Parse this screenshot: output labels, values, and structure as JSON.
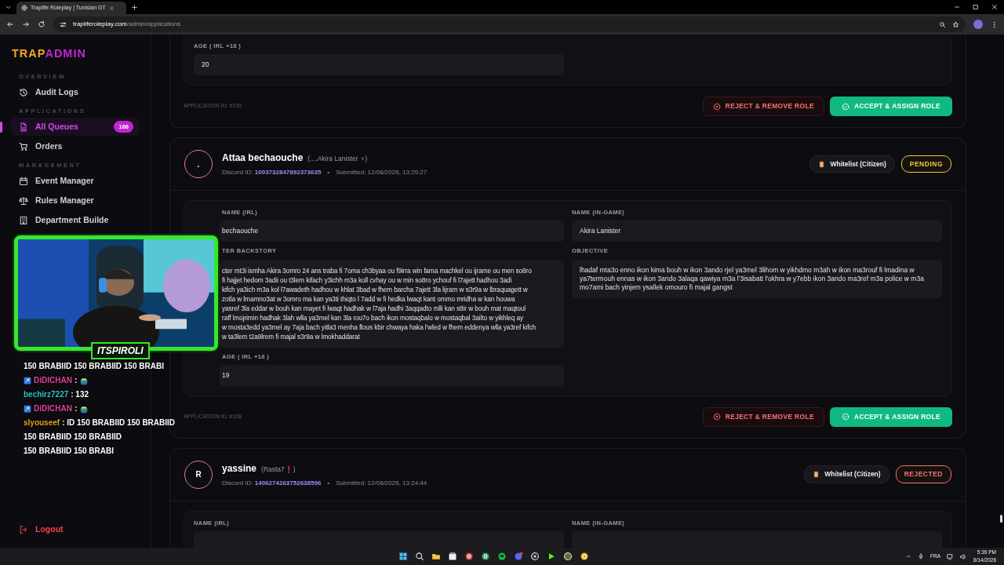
{
  "browser": {
    "tab_title": "Traplife Roleplay | Tunisian GT",
    "url_host": "trapliferoleplay.com",
    "url_path": "/admin/applications"
  },
  "sidebar": {
    "logo": {
      "part1": "TRAP",
      "part2": "ADMIN"
    },
    "sections": [
      {
        "heading": "OVERVIEW",
        "items": [
          {
            "kind": "history",
            "label": "Audit Logs",
            "selected": false
          }
        ]
      },
      {
        "heading": "APPLICATIONS",
        "items": [
          {
            "kind": "file",
            "label": "All Queues",
            "selected": true,
            "badge": "166"
          },
          {
            "kind": "cart",
            "label": "Orders",
            "selected": false
          }
        ]
      },
      {
        "heading": "MANAGEMENT",
        "items": [
          {
            "kind": "calendar",
            "label": "Event Manager",
            "selected": false
          },
          {
            "kind": "scale",
            "label": "Rules Manager",
            "selected": false
          },
          {
            "kind": "building",
            "label": "Department Builde",
            "selected": false
          }
        ]
      }
    ],
    "logout": "Logout"
  },
  "applications": [
    {
      "kind": "partial",
      "fields": [
        {
          "label": "AGE ( IRL +18 )",
          "value": "20"
        }
      ],
      "app_id": "APPLICATION ID: #109",
      "reject": "REJECT & REMOVE ROLE",
      "accept": "ACCEPT & ASSIGN ROLE"
    },
    {
      "kind": "full",
      "avatar": ".",
      "name": "Attaa bechaouche",
      "alias": "(....Akira Lanister ♆)",
      "discord_label": "Discord ID:",
      "discord_id": "1003732847892373635",
      "submitted": "Submitted: 12/08/2026, 13:25:27",
      "type": "Whitelist (Citizen)",
      "separator": "•",
      "status": "PENDING",
      "color": "#f5c542",
      "overlay_cut": true,
      "fields": [
        {
          "label": "NAME (IRL)",
          "value": "bechaouche"
        },
        {
          "label": "NAME (IN-GAME)",
          "value": "Akira Lanister"
        },
        {
          "label": "TER BACKSTORY",
          "lines": [
            "cter mt3i ismha Akira  3omro 24  ans traba fi 7oma ch3byaa ou f9irra win fama machkel ou ijrame ou men so8ro",
            "fi hajjet hedom 3adii ou t3lem kifach y3ichh m3a koll cvhay ou  w min so8ro ychouf fi l7ajett hadhou 3adi",
            "kifch ya3ich m3a kol l7awadeth hadhou w khlat 3bad w fhem barcha 7ajett 3la lijram w s3r9a w lbraquagett w",
            "zotla w lmamno3at w 3omro ma kan ya3ti thiqto l 7add w fi hedka  lwaqt kant ommo mridha w kan houwa",
            "yasref 3la eddar w bouh kan mayet fi lwaqt hadhak w l7aja hadhi 3aqqadto mlli kan s8ir w bouh mat maqtoul",
            "raff lmojrimin hadhak 3lah wlla ya3mel kan 3la rou7o bach ikon mostaqbalo w mostaqbal 3ailto w yikhleq ay",
            "w mosta3edd ya3mel ay 7aja bach yitla3 menha flous kbir chwaya haka l'wled w fhem eddenya wlla ya3ref kifch",
            "w ta3lem t2a9lrem fi majal s3r9a w lmokhaddarat"
          ]
        },
        {
          "label": "OBJECTIVE",
          "value": "lhadaf mta3o enno ikon kima bouh w ikon 3ando rjel ya3mel 3lihom w yikhdmo m3ah w ikon ma3rouf fi lmadina w ya7termouh ennas w ikon 3ando 3alaqa qawiya m3a l'3isabatt l'okhra w y7ebb ikon 3ando ma3ref m3a police w m3a mo7ami bach yinjem ysallek omouro fi majal gangst"
        },
        {
          "label": "AGE ( IRL +18 )",
          "value": "19"
        }
      ],
      "app_id": "APPLICATION ID: #108",
      "reject": "REJECT & REMOVE ROLE",
      "accept": "ACCEPT & ASSIGN ROLE"
    },
    {
      "kind": "full",
      "avatar": "R",
      "name": "yassine",
      "alias": "(Rasta7❗)",
      "discord_label": "Discord ID:",
      "discord_id": "1406274263752638596",
      "submitted": "Submitted: 12/08/2026, 13:24:44",
      "type": "Whitelist (Citizen)",
      "separator": "•",
      "status": "REJECTED",
      "color": "#f87171",
      "overlay_cut": false,
      "fields": [
        {
          "label": "NAME (IRL)"
        },
        {
          "label": "NAME (IN-GAME)"
        }
      ]
    }
  ],
  "stream": {
    "streamer": "ITSPIROLI",
    "chat": [
      {
        "kind": "text",
        "text": "150 BRABIID 150 BRABIID 150 BRABI"
      },
      {
        "kind": "message",
        "badge": true,
        "user": "DiDICHAN",
        "color": "#e0409a",
        "text": ":",
        "emote": true
      },
      {
        "kind": "message",
        "badge": false,
        "user": "bechirz7227",
        "color": "#2ec4c4",
        "text": ": 132",
        "emote": false
      },
      {
        "kind": "message",
        "badge": true,
        "user": "DiDICHAN",
        "color": "#e0409a",
        "text": ":",
        "emote": true
      },
      {
        "kind": "message",
        "badge": false,
        "user": "slyouseef",
        "color": "#e0a020",
        "text": ": ID 150 BRABIID 150 BRABIID",
        "emote": false
      },
      {
        "kind": "text",
        "text": "150 BRABIID 150 BRABIID"
      },
      {
        "kind": "text",
        "text": "150 BRABIID 150 BRABI"
      }
    ]
  },
  "taskbar": {
    "language": "FRA",
    "time": "5:39 PM",
    "date": "8/14/2026"
  }
}
